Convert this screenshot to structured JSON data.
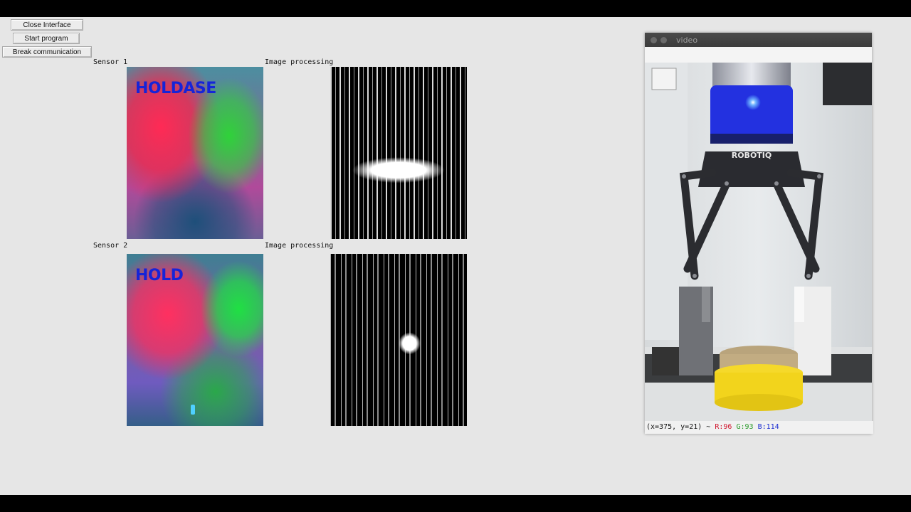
{
  "buttons": {
    "close_interface": "Close Interface",
    "start_program": "Start program",
    "break_communication": "Break communication"
  },
  "labels": {
    "sensor1": "Sensor 1",
    "sensor2": "Sensor 2",
    "processing1": "Image processing",
    "processing2": "Image processing"
  },
  "sensor1_overlay": "HOLDASE",
  "sensor2_overlay": "HOLD",
  "video_window": {
    "title": "video",
    "status": {
      "coords": "(x=375, y=21) ~",
      "r": "R:96",
      "g": "G:93",
      "b": "B:114"
    },
    "gripper_brand": "ROBOTIQ"
  },
  "colors": {
    "overlay_text": "#1624d8",
    "status_r": "#d0142c",
    "status_g": "#2a9a2a",
    "status_b": "#1a2bd0",
    "led": "#1f2cff",
    "object_yellow": "#f2d41c"
  }
}
